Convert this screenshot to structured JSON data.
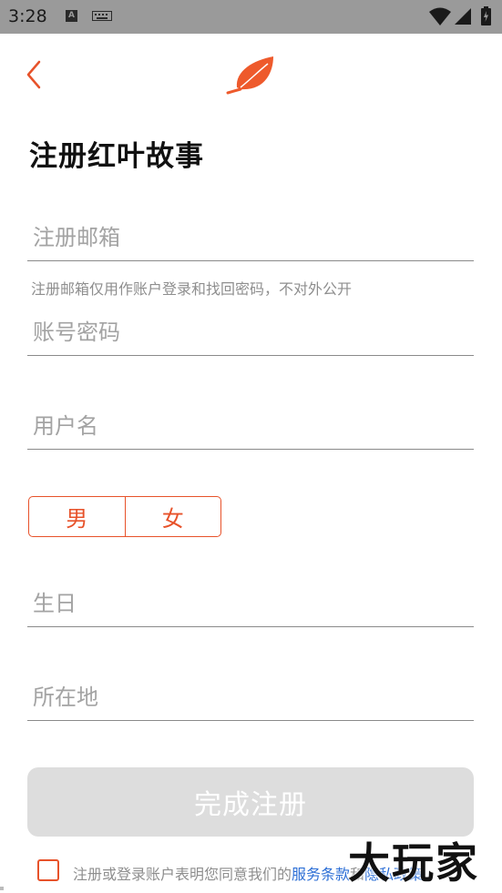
{
  "status_bar": {
    "time": "3:28",
    "icons": [
      "a-notification-icon",
      "keyboard-icon",
      "wifi-icon",
      "signal-icon",
      "battery-charging-icon"
    ]
  },
  "header": {
    "back_icon": "chevron-left-icon",
    "logo_icon": "red-leaf-logo-icon"
  },
  "title": "注册红叶故事",
  "form": {
    "email_placeholder": "注册邮箱",
    "email_value": "",
    "email_hint": "注册邮箱仅用作账户登录和找回密码，不对外公开",
    "password_placeholder": "账号密码",
    "password_value": "",
    "username_placeholder": "用户名",
    "username_value": "",
    "gender_male": "男",
    "gender_female": "女",
    "birthday_placeholder": "生日",
    "location_placeholder": "所在地"
  },
  "submit_label": "完成注册",
  "agreement": {
    "prefix": "注册或登录账户表明您同意我们的",
    "terms_link": "服务条款",
    "connector": "和",
    "privacy_link": "隐私政策"
  },
  "watermark": "大玩家",
  "colors": {
    "accent": "#e7522a",
    "status_bar": "#9a9a9a",
    "disabled_button": "#dddddd",
    "link": "#2d6fd6"
  }
}
